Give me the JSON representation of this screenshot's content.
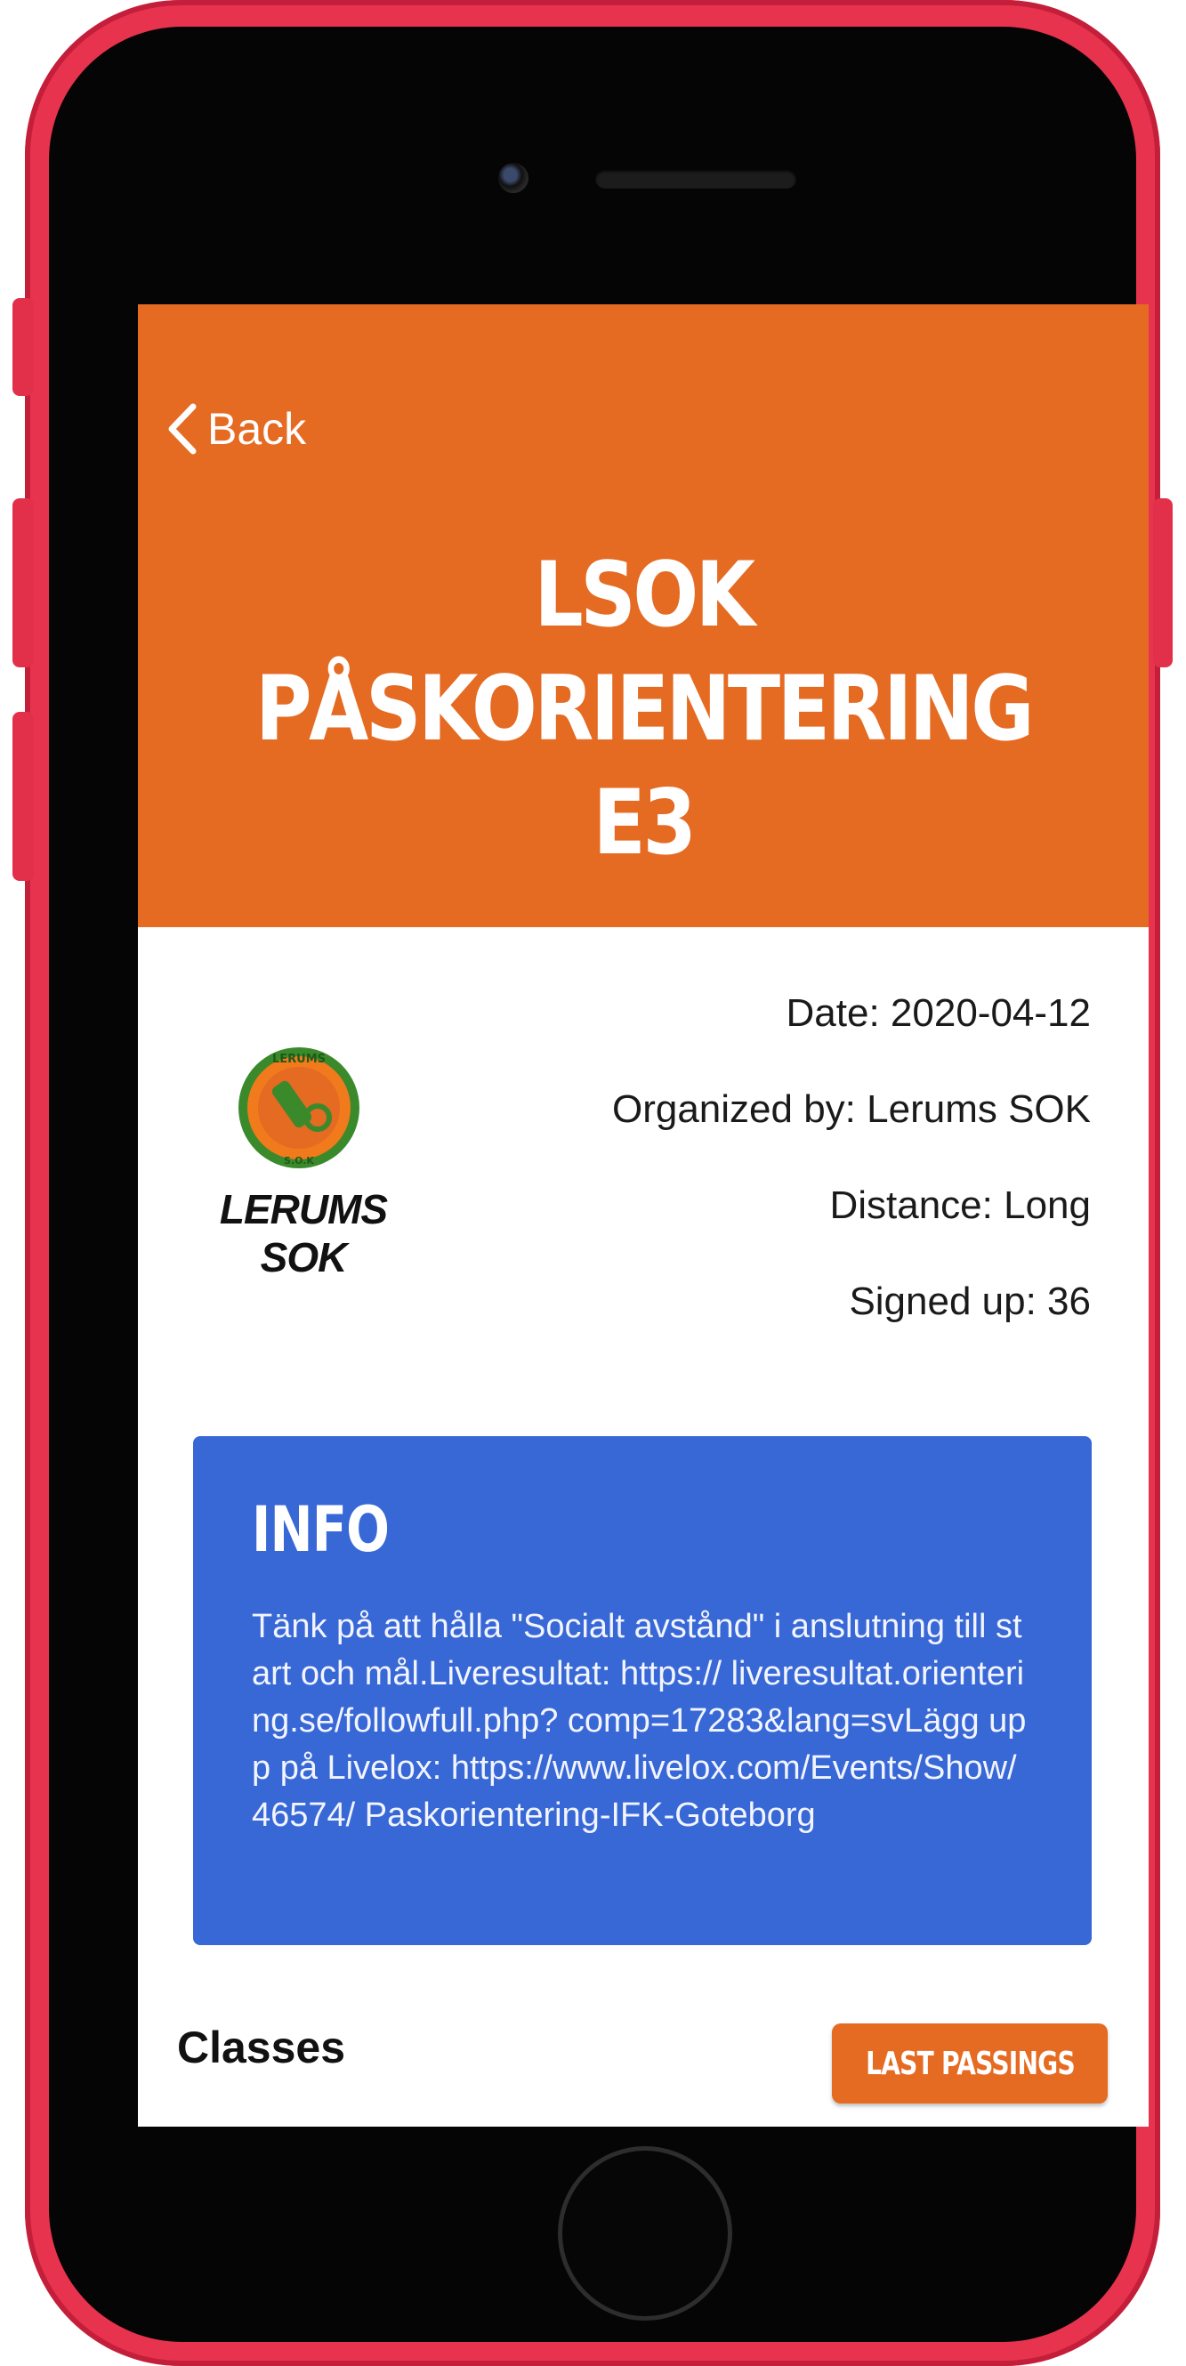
{
  "header": {
    "back_label": "Back",
    "title_line1": "LSOK PÅSKORIENTERING",
    "title_line2": "E3",
    "color": "#e56a22"
  },
  "organizer_logo": {
    "name": "LERUMS SOK"
  },
  "details": {
    "date": "Date: 2020-04-12",
    "organized_by": "Organized by: Lerums SOK",
    "distance": "Distance: Long",
    "signed_up": "Signed up: 36"
  },
  "info": {
    "title": "INFO",
    "text": "Tänk på att hålla \"Socialt avstånd\" i anslutning till start och mål.Liveresultat: https:// liveresultat.orientering.se/followfull.php? comp=17283&lang=svLägg upp på Livelox: https://www.livelox.com/Events/Show/46574/ Paskorientering-IFK-Goteborg",
    "color": "#3867d6"
  },
  "classes": {
    "heading": "Classes",
    "last_passings_label": "LAST PASSINGS"
  },
  "icons": {
    "back": "chevron-left-icon",
    "camera": "camera-icon"
  }
}
